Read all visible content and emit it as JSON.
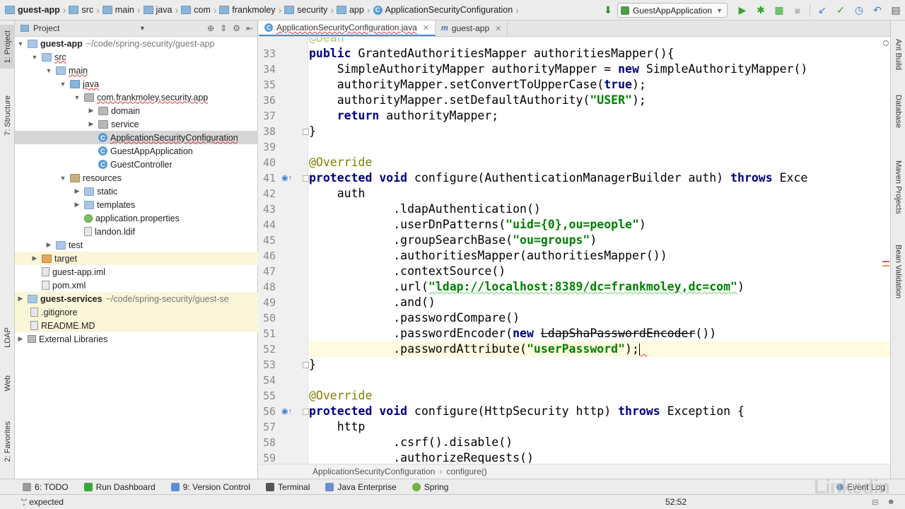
{
  "navbar": {
    "breadcrumbs": [
      "guest-app",
      "src",
      "main",
      "java",
      "com",
      "frankmoley",
      "security",
      "app",
      "ApplicationSecurityConfiguration"
    ],
    "run_config": "GuestAppApplication"
  },
  "left_stripe": {
    "tabs": [
      "1: Project",
      "7: Structure",
      "LDAP",
      "Web",
      "2: Favorites"
    ]
  },
  "right_stripe": {
    "tabs": [
      "Ant Build",
      "Database",
      "Maven Projects",
      "Bean Validation"
    ]
  },
  "project_panel": {
    "title": "Project",
    "tree": [
      {
        "label": "guest-app",
        "path": "~/code/spring-security/guest-app"
      },
      {
        "label": "src"
      },
      {
        "label": "main"
      },
      {
        "label": "java"
      },
      {
        "label": "com.frankmoley.security.app"
      },
      {
        "label": "domain"
      },
      {
        "label": "service"
      },
      {
        "label": "ApplicationSecurityConfiguration"
      },
      {
        "label": "GuestAppApplication"
      },
      {
        "label": "GuestController"
      },
      {
        "label": "resources"
      },
      {
        "label": "static"
      },
      {
        "label": "templates"
      },
      {
        "label": "application.properties"
      },
      {
        "label": "landon.ldif"
      },
      {
        "label": "test"
      },
      {
        "label": "target"
      },
      {
        "label": "guest-app.iml"
      },
      {
        "label": "pom.xml"
      },
      {
        "label": "guest-services",
        "path": "~/code/spring-security/guest-se"
      },
      {
        "label": ".gitignore"
      },
      {
        "label": "README.MD"
      },
      {
        "label": "External Libraries"
      }
    ]
  },
  "editor_tabs": [
    {
      "label": "ApplicationSecurityConfiguration.java",
      "icon": "class-icon"
    },
    {
      "label": "guest-app",
      "icon": "maven-icon"
    }
  ],
  "editor": {
    "line_numbers": [
      "33",
      "34",
      "35",
      "36",
      "37",
      "38",
      "39",
      "40",
      "41",
      "42",
      "43",
      "44",
      "45",
      "46",
      "47",
      "48",
      "49",
      "50",
      "51",
      "52",
      "53",
      "54",
      "55",
      "56",
      "57",
      "58",
      "59"
    ],
    "top_fragment": "@Bean",
    "code": {
      "l33_kw": "public",
      "l33_rest": " GrantedAuthoritiesMapper authoritiesMapper(){",
      "l34_a": "    SimpleAuthorityMapper authorityMapper = ",
      "l34_kw": "new",
      "l34_b": " SimpleAuthorityMapper()",
      "l35_a": "    authorityMapper.setConvertToUpperCase(",
      "l35_kw": "true",
      "l35_b": ");",
      "l36_a": "    authorityMapper.setDefaultAuthority(",
      "l36_str": "\"USER\"",
      "l36_b": ");",
      "l37_kw": "    return",
      "l37_rest": " authorityMapper;",
      "l38": "}",
      "l40": "@Override",
      "l41_kw1": "protected",
      "l41_kw2": "void",
      "l41_rest": " configure(AuthenticationManagerBuilder auth) ",
      "l41_kw3": "throws",
      "l41_tail": " Exce",
      "l42": "    auth",
      "l43": "            .ldapAuthentication()",
      "l44_a": "            .userDnPatterns(",
      "l44_str": "\"uid={0},ou=people\"",
      "l44_b": ")",
      "l45_a": "            .groupSearchBase(",
      "l45_str": "\"ou=groups\"",
      "l45_b": ")",
      "l46": "            .authoritiesMapper(authoritiesMapper())",
      "l47": "            .contextSource()",
      "l48_a": "            .url(",
      "l48_str": "\"ldap://localhost:8389/dc=frankmoley,dc=com\"",
      "l48_b": ")",
      "l49": "            .and()",
      "l50": "            .passwordCompare()",
      "l51_a": "            .passwordEncoder(",
      "l51_kw": "new",
      "l51_strike": "LdapShaPasswordEncoder",
      "l51_b": "())",
      "l52_a": "            .passwordAttribute(",
      "l52_str": "\"userPassword\"",
      "l52_b": ");",
      "l53": "}",
      "l55": "@Override",
      "l56_kw1": "protected",
      "l56_kw2": "void",
      "l56_rest": " configure(HttpSecurity http) ",
      "l56_kw3": "throws",
      "l56_tail": " Exception {",
      "l57": "    http",
      "l58": "            .csrf().disable()",
      "l59": "            .authorizeRequests()"
    },
    "breadcrumb": [
      "ApplicationSecurityConfiguration",
      "configure()"
    ]
  },
  "bottom_bar": {
    "items": [
      "6: TODO",
      "Run Dashboard",
      "9: Version Control",
      "Terminal",
      "Java Enterprise",
      "Spring"
    ],
    "event_log": "Event Log"
  },
  "status_bar": {
    "message": "';' expected",
    "position": "52:52"
  },
  "watermark": "Linkedin"
}
